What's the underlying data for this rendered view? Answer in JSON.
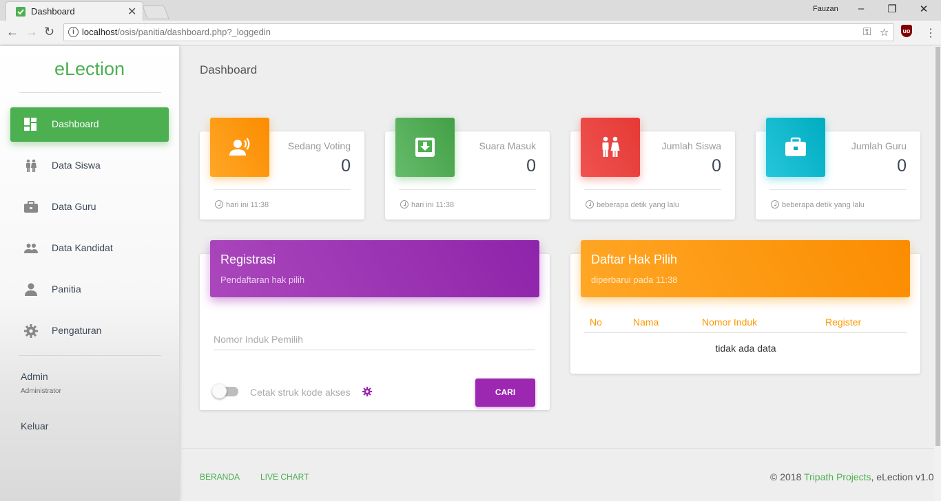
{
  "browser": {
    "tab_title": "Dashboard",
    "tab_close": "✕",
    "user": "Fauzan",
    "url_host": "localhost",
    "url_path": "/osis/panitia/dashboard.php?_loggedin"
  },
  "sidebar": {
    "brand": "eLection",
    "items": [
      {
        "label": "Dashboard",
        "icon": "dashboard-icon"
      },
      {
        "label": "Data Siswa",
        "icon": "people-icon"
      },
      {
        "label": "Data Guru",
        "icon": "briefcase-icon"
      },
      {
        "label": "Data Kandidat",
        "icon": "group-icon"
      },
      {
        "label": "Panitia",
        "icon": "person-icon"
      },
      {
        "label": "Pengaturan",
        "icon": "gear-icon"
      }
    ],
    "user_name": "Admin",
    "user_role": "Administrator",
    "logout": "Keluar"
  },
  "main": {
    "title": "Dashboard",
    "stats": [
      {
        "label": "Sedang Voting",
        "value": "0",
        "foot": "hari ini 11:38",
        "color": "#ff9800"
      },
      {
        "label": "Suara Masuk",
        "value": "0",
        "foot": "hari ini 11:38",
        "color": "#4caf50"
      },
      {
        "label": "Jumlah Siswa",
        "value": "0",
        "foot": "beberapa detik yang lalu",
        "color": "#f44336"
      },
      {
        "label": "Jumlah Guru",
        "value": "0",
        "foot": "beberapa detik yang lalu",
        "color": "#00bcd4"
      }
    ],
    "registrasi": {
      "title": "Registrasi",
      "subtitle": "Pendaftaran hak pilih",
      "input_placeholder": "Nomor Induk Pemilih",
      "input_value": "",
      "toggle_label": "Cetak struk kode akses",
      "button": "CARI"
    },
    "hak_pilih": {
      "title": "Daftar Hak Pilih",
      "subtitle": "diperbarui pada 11:38",
      "columns": [
        "No",
        "Nama",
        "Nomor Induk",
        "Register"
      ],
      "empty": "tidak ada data"
    }
  },
  "footer": {
    "links": [
      "BERANDA",
      "LIVE CHART"
    ],
    "copy_prefix": "© 2018 ",
    "copy_link": "Tripath Projects",
    "copy_suffix": ", eLection v1.0"
  }
}
